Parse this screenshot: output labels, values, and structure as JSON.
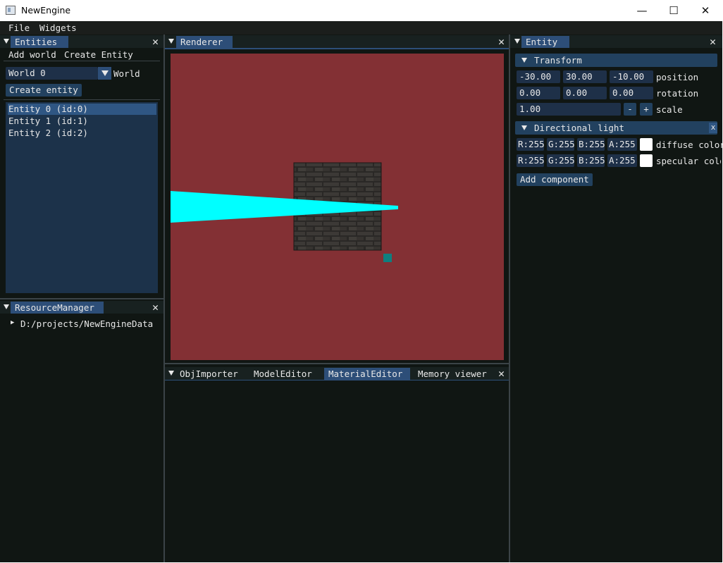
{
  "window": {
    "title": "NewEngine",
    "minimize": "—",
    "maximize": "☐",
    "close": "✕"
  },
  "menu": [
    "File",
    "Widgets"
  ],
  "entities_panel": {
    "tab": "Entities",
    "toolbar": [
      "Add world",
      "Create Entity"
    ],
    "world_select": {
      "value": "World 0",
      "label": "World"
    },
    "create_button": "Create entity",
    "items": [
      "Entity 0 (id:0)",
      "Entity 1 (id:1)",
      "Entity 2 (id:2)"
    ]
  },
  "resource_panel": {
    "tab": "ResourceManager",
    "tree_item": "D:/projects/NewEngineData"
  },
  "renderer_panel": {
    "tab": "Renderer",
    "background": "#833034",
    "beam_color": "#00ffff",
    "marker_color": "#0f7f7f"
  },
  "bottom_panel": {
    "tabs": [
      "ObjImporter",
      "ModelEditor",
      "MaterialEditor",
      "Memory viewer"
    ],
    "active_tab": "MaterialEditor"
  },
  "entity_panel": {
    "tab": "Entity",
    "transform": {
      "header": "Transform",
      "position": [
        "-30.00",
        "30.00",
        "-10.00"
      ],
      "position_label": "position",
      "rotation": [
        "0.00",
        "0.00",
        "0.00"
      ],
      "rotation_label": "rotation",
      "scale": "1.00",
      "minus": "-",
      "plus": "+",
      "scale_label": "scale"
    },
    "light": {
      "header": "Directional light",
      "remove": "x",
      "diffuse": [
        "R:255",
        "G:255",
        "B:255",
        "A:255"
      ],
      "diffuse_label": "diffuse color",
      "specular": [
        "R:255",
        "G:255",
        "B:255",
        "A:255"
      ],
      "specular_label": "specular color"
    },
    "add_component": "Add component"
  }
}
